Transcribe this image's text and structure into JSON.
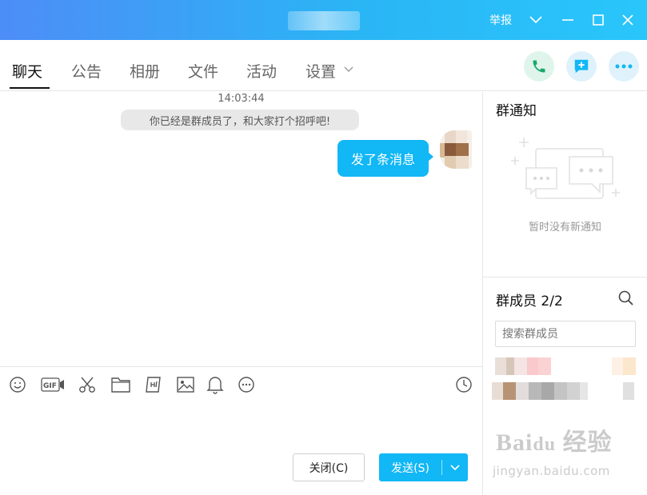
{
  "window": {
    "report_label": "举报"
  },
  "tabs": [
    {
      "label": "聊天",
      "active": true
    },
    {
      "label": "公告"
    },
    {
      "label": "相册"
    },
    {
      "label": "文件"
    },
    {
      "label": "活动"
    },
    {
      "label": "设置"
    }
  ],
  "chat": {
    "timestamp": "14:03:44",
    "system_message": "你已经是群成员了，和大家打个招呼吧!",
    "messages": [
      {
        "text": "发了条消息",
        "self": true
      }
    ]
  },
  "input_toolbar": {
    "icons": [
      "emoji-icon",
      "gif-icon",
      "scissors-icon",
      "folder-icon",
      "sticker-icon",
      "image-icon",
      "bell-icon",
      "more-icon",
      "history-icon"
    ]
  },
  "actions": {
    "close_label": "关闭(C)",
    "send_label": "发送(S)"
  },
  "sidebar": {
    "notice_title": "群通知",
    "notice_empty": "暂时没有新通知",
    "members_title": "群成员 2/2",
    "member_search_placeholder": "搜索群成员"
  },
  "colors": {
    "accent": "#12b7f5",
    "title_gradient_start": "#4d8df7",
    "title_gradient_end": "#29c6fb"
  }
}
